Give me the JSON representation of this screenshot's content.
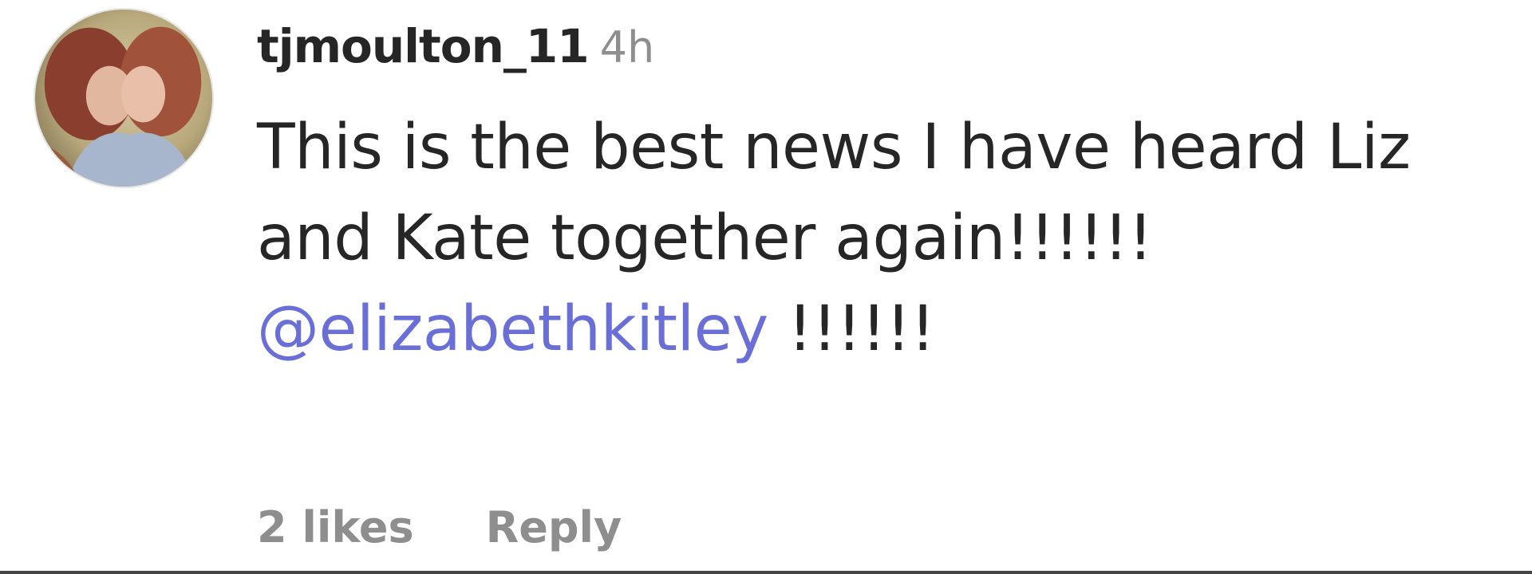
{
  "comment": {
    "username": "tjmoulton_11",
    "time": "4h",
    "text_before": "This is the best news I have heard Liz and Kate together again!!!!!! ",
    "mention": "@elizabethkitley",
    "text_after": " !!!!!!",
    "likes": "2 likes",
    "reply_label": "Reply"
  },
  "colors": {
    "mention": "#6a6fd8",
    "secondary": "#8e8e8e",
    "primary_text": "#262626"
  }
}
